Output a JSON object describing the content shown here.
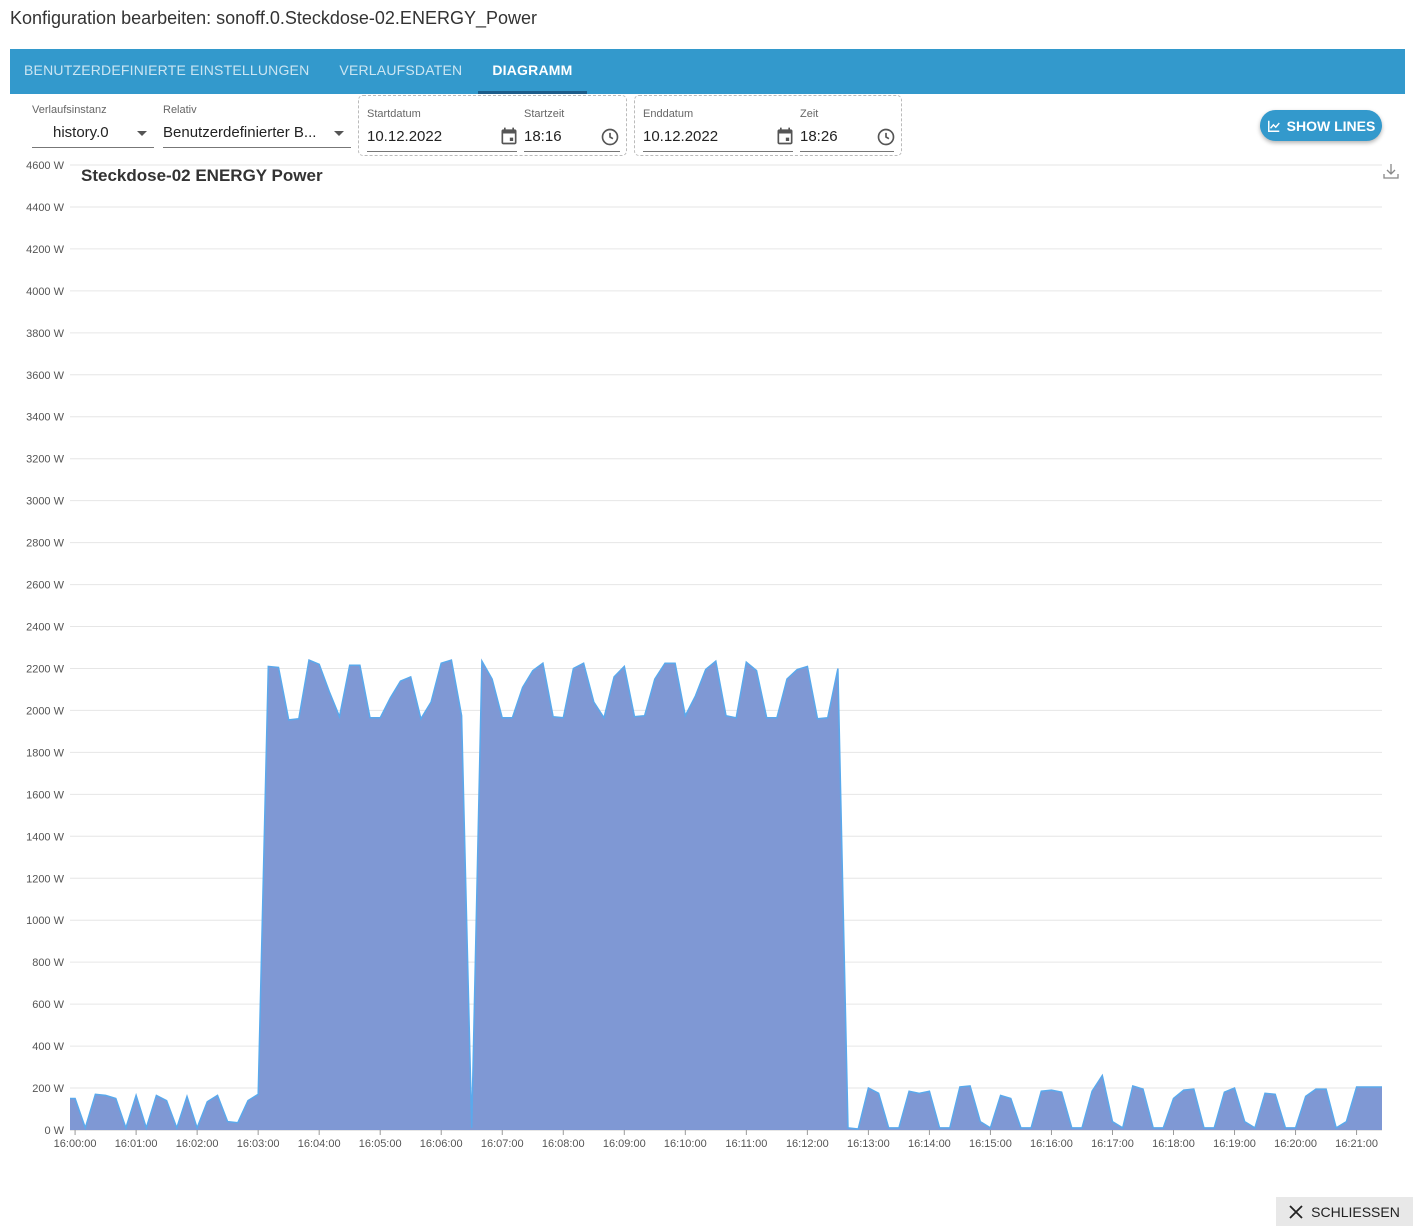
{
  "dialog": {
    "title": "Konfiguration bearbeiten: sonoff.0.Steckdose-02.ENERGY_Power"
  },
  "tabs": [
    {
      "label": "BENUTZERDEFINIERTE EINSTELLUNGEN"
    },
    {
      "label": "VERLAUFSDATEN"
    },
    {
      "label": "DIAGRAMM"
    }
  ],
  "controls": {
    "instance": {
      "label": "Verlaufsinstanz",
      "value": "history.0"
    },
    "relative": {
      "label": "Relativ",
      "value": "Benutzerdefinierter B..."
    },
    "start_date": {
      "label": "Startdatum",
      "value": "10.12.2022"
    },
    "start_time": {
      "label": "Startzeit",
      "value": "18:16"
    },
    "end_date": {
      "label": "Enddatum",
      "value": "10.12.2022"
    },
    "end_time": {
      "label": "Zeit",
      "value": "18:26"
    },
    "show_lines": "SHOW LINES"
  },
  "close_label": "SCHLIESSEN",
  "colors": {
    "accent": "#3399cc",
    "area_fill": "#7f98d4",
    "area_line": "#5aa9ec"
  },
  "chart_data": {
    "type": "area",
    "title": "Steckdose-02 ENERGY  Power",
    "y_unit": "W",
    "ylim": [
      0,
      4600
    ],
    "y_ticks": [
      "0 W",
      "200 W",
      "400 W",
      "600 W",
      "800 W",
      "1000 W",
      "1200 W",
      "1400 W",
      "1600 W",
      "1800 W",
      "2000 W",
      "2200 W",
      "2400 W",
      "2600 W",
      "2800 W",
      "3000 W",
      "3200 W",
      "3400 W",
      "3600 W",
      "3800 W",
      "4000 W",
      "4200 W",
      "4400 W",
      "4600 W"
    ],
    "x_ticks": [
      "16:00:00",
      "16:01:00",
      "16:02:00",
      "16:03:00",
      "16:04:00",
      "16:05:00",
      "16:06:00",
      "16:07:00",
      "16:08:00",
      "16:09:00",
      "16:10:00",
      "16:11:00",
      "16:12:00",
      "16:13:00",
      "16:14:00",
      "16:15:00",
      "16:16:00",
      "16:17:00",
      "16:18:00",
      "16:19:00",
      "16:20:00",
      "16:21:00"
    ],
    "xlim": [
      "15:59:55",
      "16:21:25"
    ],
    "grid": true,
    "series": [
      {
        "points": [
          [
            "15:59:55",
            150
          ],
          [
            "16:00:00",
            150
          ],
          [
            "16:00:10",
            10
          ],
          [
            "16:00:20",
            170
          ],
          [
            "16:00:30",
            165
          ],
          [
            "16:00:40",
            150
          ],
          [
            "16:00:50",
            10
          ],
          [
            "16:01:00",
            165
          ],
          [
            "16:01:10",
            10
          ],
          [
            "16:01:20",
            165
          ],
          [
            "16:01:30",
            140
          ],
          [
            "16:01:40",
            10
          ],
          [
            "16:01:50",
            160
          ],
          [
            "16:02:00",
            10
          ],
          [
            "16:02:10",
            135
          ],
          [
            "16:02:20",
            165
          ],
          [
            "16:02:30",
            40
          ],
          [
            "16:02:40",
            35
          ],
          [
            "16:02:50",
            140
          ],
          [
            "16:03:00",
            170
          ],
          [
            "16:03:10",
            2210
          ],
          [
            "16:03:20",
            2205
          ],
          [
            "16:03:30",
            1955
          ],
          [
            "16:03:40",
            1960
          ],
          [
            "16:03:50",
            2240
          ],
          [
            "16:04:00",
            2220
          ],
          [
            "16:04:10",
            2090
          ],
          [
            "16:04:20",
            1970
          ],
          [
            "16:04:30",
            2215
          ],
          [
            "16:04:40",
            2215
          ],
          [
            "16:04:50",
            1965
          ],
          [
            "16:05:00",
            1965
          ],
          [
            "16:05:10",
            2060
          ],
          [
            "16:05:20",
            2140
          ],
          [
            "16:05:30",
            2160
          ],
          [
            "16:05:40",
            1960
          ],
          [
            "16:05:50",
            2040
          ],
          [
            "16:06:00",
            2225
          ],
          [
            "16:06:10",
            2240
          ],
          [
            "16:06:20",
            1975
          ],
          [
            "16:06:30",
            10
          ],
          [
            "16:06:40",
            2235
          ],
          [
            "16:06:50",
            2150
          ],
          [
            "16:07:00",
            1965
          ],
          [
            "16:07:10",
            1965
          ],
          [
            "16:07:20",
            2110
          ],
          [
            "16:07:30",
            2190
          ],
          [
            "16:07:40",
            2225
          ],
          [
            "16:07:50",
            1970
          ],
          [
            "16:08:00",
            1965
          ],
          [
            "16:08:10",
            2200
          ],
          [
            "16:08:20",
            2225
          ],
          [
            "16:08:30",
            2040
          ],
          [
            "16:08:40",
            1965
          ],
          [
            "16:08:50",
            2160
          ],
          [
            "16:09:00",
            2210
          ],
          [
            "16:09:10",
            1970
          ],
          [
            "16:09:20",
            1975
          ],
          [
            "16:09:30",
            2150
          ],
          [
            "16:09:40",
            2225
          ],
          [
            "16:09:50",
            2225
          ],
          [
            "16:10:00",
            1975
          ],
          [
            "16:10:10",
            2070
          ],
          [
            "16:10:20",
            2195
          ],
          [
            "16:10:30",
            2235
          ],
          [
            "16:10:40",
            1975
          ],
          [
            "16:10:50",
            1965
          ],
          [
            "16:11:00",
            2230
          ],
          [
            "16:11:10",
            2190
          ],
          [
            "16:11:20",
            1965
          ],
          [
            "16:11:30",
            1965
          ],
          [
            "16:11:40",
            2150
          ],
          [
            "16:11:50",
            2195
          ],
          [
            "16:12:00",
            2210
          ],
          [
            "16:12:10",
            1960
          ],
          [
            "16:12:20",
            1965
          ],
          [
            "16:12:30",
            2200
          ],
          [
            "16:12:40",
            10
          ],
          [
            "16:12:50",
            5
          ],
          [
            "16:13:00",
            200
          ],
          [
            "16:13:10",
            175
          ],
          [
            "16:13:20",
            10
          ],
          [
            "16:13:30",
            10
          ],
          [
            "16:13:40",
            185
          ],
          [
            "16:13:50",
            175
          ],
          [
            "16:14:00",
            185
          ],
          [
            "16:14:10",
            10
          ],
          [
            "16:14:20",
            10
          ],
          [
            "16:14:30",
            205
          ],
          [
            "16:14:40",
            210
          ],
          [
            "16:14:50",
            40
          ],
          [
            "16:15:00",
            10
          ],
          [
            "16:15:10",
            165
          ],
          [
            "16:15:20",
            150
          ],
          [
            "16:15:30",
            10
          ],
          [
            "16:15:40",
            10
          ],
          [
            "16:15:50",
            185
          ],
          [
            "16:16:00",
            190
          ],
          [
            "16:16:10",
            180
          ],
          [
            "16:16:20",
            10
          ],
          [
            "16:16:30",
            10
          ],
          [
            "16:16:40",
            185
          ],
          [
            "16:16:50",
            260
          ],
          [
            "16:17:00",
            40
          ],
          [
            "16:17:10",
            10
          ],
          [
            "16:17:20",
            210
          ],
          [
            "16:17:30",
            195
          ],
          [
            "16:17:40",
            10
          ],
          [
            "16:17:50",
            10
          ],
          [
            "16:18:00",
            150
          ],
          [
            "16:18:10",
            190
          ],
          [
            "16:18:20",
            195
          ],
          [
            "16:18:30",
            10
          ],
          [
            "16:18:40",
            10
          ],
          [
            "16:18:50",
            180
          ],
          [
            "16:19:00",
            200
          ],
          [
            "16:19:10",
            40
          ],
          [
            "16:19:20",
            10
          ],
          [
            "16:19:30",
            175
          ],
          [
            "16:19:40",
            170
          ],
          [
            "16:19:50",
            10
          ],
          [
            "16:20:00",
            10
          ],
          [
            "16:20:10",
            160
          ],
          [
            "16:20:20",
            195
          ],
          [
            "16:20:30",
            195
          ],
          [
            "16:20:40",
            10
          ],
          [
            "16:20:50",
            40
          ],
          [
            "16:21:00",
            205
          ],
          [
            "16:21:25",
            205
          ]
        ]
      }
    ]
  }
}
